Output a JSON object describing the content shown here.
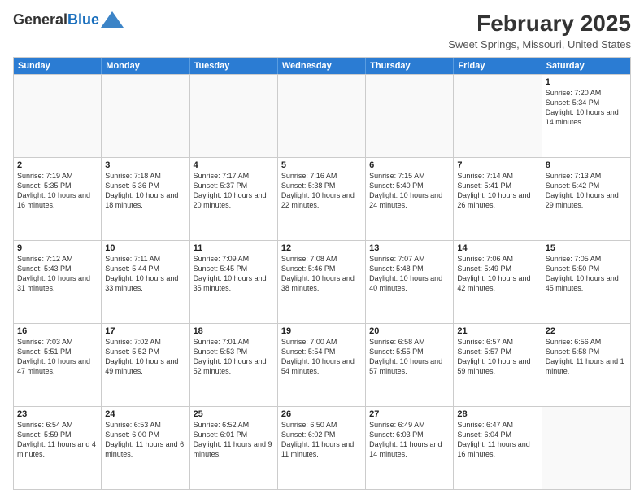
{
  "header": {
    "logo_line1": "General",
    "logo_line2": "Blue",
    "month_title": "February 2025",
    "location": "Sweet Springs, Missouri, United States"
  },
  "weekdays": [
    "Sunday",
    "Monday",
    "Tuesday",
    "Wednesday",
    "Thursday",
    "Friday",
    "Saturday"
  ],
  "weeks": [
    [
      {
        "day": "",
        "text": "",
        "empty": true
      },
      {
        "day": "",
        "text": "",
        "empty": true
      },
      {
        "day": "",
        "text": "",
        "empty": true
      },
      {
        "day": "",
        "text": "",
        "empty": true
      },
      {
        "day": "",
        "text": "",
        "empty": true
      },
      {
        "day": "",
        "text": "",
        "empty": true
      },
      {
        "day": "1",
        "text": "Sunrise: 7:20 AM\nSunset: 5:34 PM\nDaylight: 10 hours and 14 minutes.",
        "empty": false
      }
    ],
    [
      {
        "day": "2",
        "text": "Sunrise: 7:19 AM\nSunset: 5:35 PM\nDaylight: 10 hours and 16 minutes.",
        "empty": false
      },
      {
        "day": "3",
        "text": "Sunrise: 7:18 AM\nSunset: 5:36 PM\nDaylight: 10 hours and 18 minutes.",
        "empty": false
      },
      {
        "day": "4",
        "text": "Sunrise: 7:17 AM\nSunset: 5:37 PM\nDaylight: 10 hours and 20 minutes.",
        "empty": false
      },
      {
        "day": "5",
        "text": "Sunrise: 7:16 AM\nSunset: 5:38 PM\nDaylight: 10 hours and 22 minutes.",
        "empty": false
      },
      {
        "day": "6",
        "text": "Sunrise: 7:15 AM\nSunset: 5:40 PM\nDaylight: 10 hours and 24 minutes.",
        "empty": false
      },
      {
        "day": "7",
        "text": "Sunrise: 7:14 AM\nSunset: 5:41 PM\nDaylight: 10 hours and 26 minutes.",
        "empty": false
      },
      {
        "day": "8",
        "text": "Sunrise: 7:13 AM\nSunset: 5:42 PM\nDaylight: 10 hours and 29 minutes.",
        "empty": false
      }
    ],
    [
      {
        "day": "9",
        "text": "Sunrise: 7:12 AM\nSunset: 5:43 PM\nDaylight: 10 hours and 31 minutes.",
        "empty": false
      },
      {
        "day": "10",
        "text": "Sunrise: 7:11 AM\nSunset: 5:44 PM\nDaylight: 10 hours and 33 minutes.",
        "empty": false
      },
      {
        "day": "11",
        "text": "Sunrise: 7:09 AM\nSunset: 5:45 PM\nDaylight: 10 hours and 35 minutes.",
        "empty": false
      },
      {
        "day": "12",
        "text": "Sunrise: 7:08 AM\nSunset: 5:46 PM\nDaylight: 10 hours and 38 minutes.",
        "empty": false
      },
      {
        "day": "13",
        "text": "Sunrise: 7:07 AM\nSunset: 5:48 PM\nDaylight: 10 hours and 40 minutes.",
        "empty": false
      },
      {
        "day": "14",
        "text": "Sunrise: 7:06 AM\nSunset: 5:49 PM\nDaylight: 10 hours and 42 minutes.",
        "empty": false
      },
      {
        "day": "15",
        "text": "Sunrise: 7:05 AM\nSunset: 5:50 PM\nDaylight: 10 hours and 45 minutes.",
        "empty": false
      }
    ],
    [
      {
        "day": "16",
        "text": "Sunrise: 7:03 AM\nSunset: 5:51 PM\nDaylight: 10 hours and 47 minutes.",
        "empty": false
      },
      {
        "day": "17",
        "text": "Sunrise: 7:02 AM\nSunset: 5:52 PM\nDaylight: 10 hours and 49 minutes.",
        "empty": false
      },
      {
        "day": "18",
        "text": "Sunrise: 7:01 AM\nSunset: 5:53 PM\nDaylight: 10 hours and 52 minutes.",
        "empty": false
      },
      {
        "day": "19",
        "text": "Sunrise: 7:00 AM\nSunset: 5:54 PM\nDaylight: 10 hours and 54 minutes.",
        "empty": false
      },
      {
        "day": "20",
        "text": "Sunrise: 6:58 AM\nSunset: 5:55 PM\nDaylight: 10 hours and 57 minutes.",
        "empty": false
      },
      {
        "day": "21",
        "text": "Sunrise: 6:57 AM\nSunset: 5:57 PM\nDaylight: 10 hours and 59 minutes.",
        "empty": false
      },
      {
        "day": "22",
        "text": "Sunrise: 6:56 AM\nSunset: 5:58 PM\nDaylight: 11 hours and 1 minute.",
        "empty": false
      }
    ],
    [
      {
        "day": "23",
        "text": "Sunrise: 6:54 AM\nSunset: 5:59 PM\nDaylight: 11 hours and 4 minutes.",
        "empty": false
      },
      {
        "day": "24",
        "text": "Sunrise: 6:53 AM\nSunset: 6:00 PM\nDaylight: 11 hours and 6 minutes.",
        "empty": false
      },
      {
        "day": "25",
        "text": "Sunrise: 6:52 AM\nSunset: 6:01 PM\nDaylight: 11 hours and 9 minutes.",
        "empty": false
      },
      {
        "day": "26",
        "text": "Sunrise: 6:50 AM\nSunset: 6:02 PM\nDaylight: 11 hours and 11 minutes.",
        "empty": false
      },
      {
        "day": "27",
        "text": "Sunrise: 6:49 AM\nSunset: 6:03 PM\nDaylight: 11 hours and 14 minutes.",
        "empty": false
      },
      {
        "day": "28",
        "text": "Sunrise: 6:47 AM\nSunset: 6:04 PM\nDaylight: 11 hours and 16 minutes.",
        "empty": false
      },
      {
        "day": "",
        "text": "",
        "empty": true
      }
    ]
  ]
}
